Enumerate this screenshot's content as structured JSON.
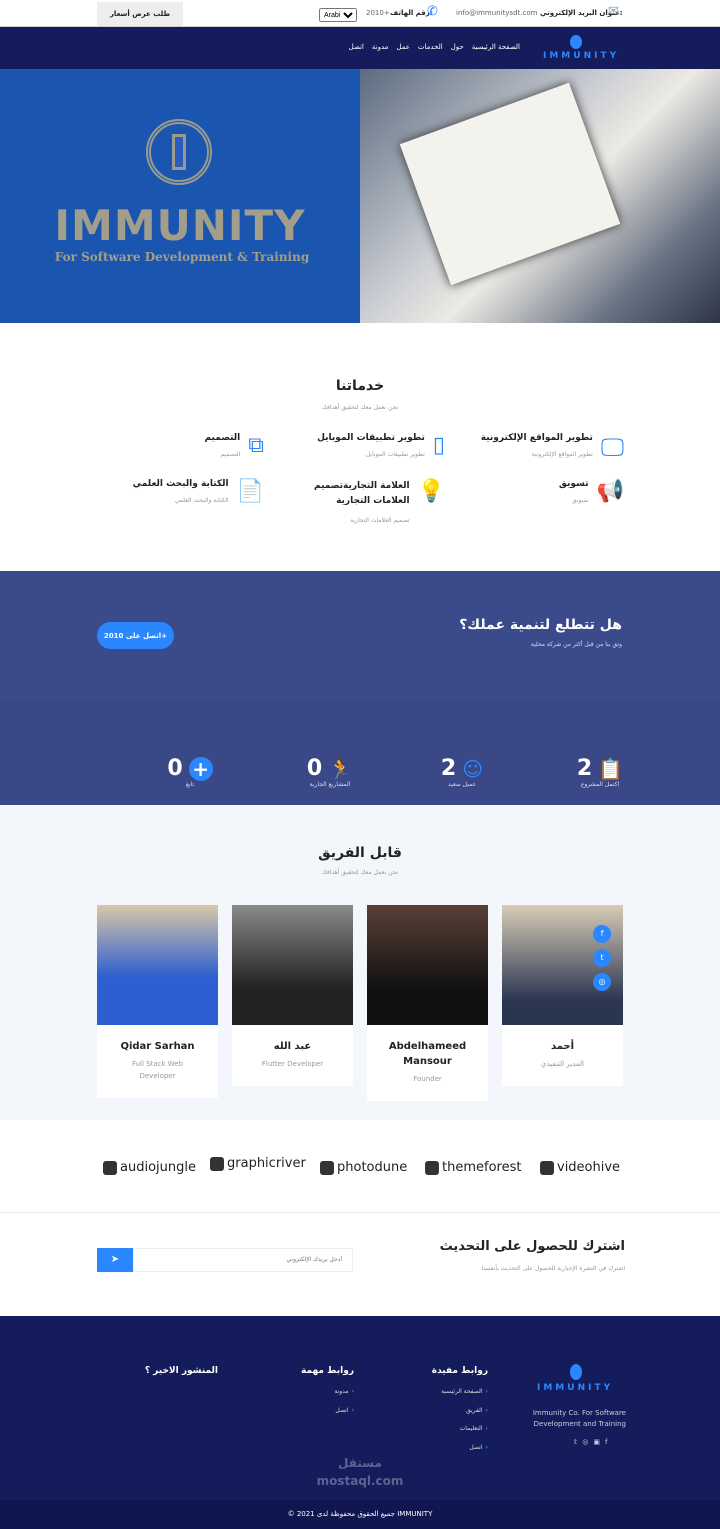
{
  "topbar": {
    "quote_button": "طلب عرض أسعار",
    "language": "Arabic",
    "phone_label": "رقم الهاتف:",
    "phone": "2010+",
    "email_label": "عنوان البريد الإلكتروني:",
    "email": "info@immunitysdt.com"
  },
  "nav": {
    "logo": "IMMUNITY",
    "items": [
      "الصفحة الرئيسية",
      "حول",
      "الخدمات",
      "عمل",
      "مدونة",
      "اتصل"
    ]
  },
  "hero": {
    "brand": "IMMUNITY",
    "tagline": "For Software Development & Training"
  },
  "services": {
    "title": "خدماتنا",
    "subtitle": "نحن نعمل معك لتحقيق أهدافك",
    "items": [
      {
        "title": "تطوير المواقع الإلكترونية",
        "desc": "تطوير المواقع الإلكترونية",
        "icon": "monitor-icon"
      },
      {
        "title": "تطوير تطبيقات الموبايل",
        "desc": "تطوير تطبيقات الموبايل",
        "icon": "mobile-icon"
      },
      {
        "title": "التصميم",
        "desc": "التصميم",
        "icon": "design-icon"
      },
      {
        "title": "تسويق",
        "desc": "تسويق",
        "icon": "megaphone-icon"
      },
      {
        "title": "العلامة التجاريةتصميم العلامات التجارية",
        "desc": "تصميم العلامات التجارية",
        "icon": "lightbulb-icon"
      },
      {
        "title": "الكتابة والبحث العلمي",
        "desc": "الكتابة والبحث العلمي",
        "icon": "document-icon"
      }
    ]
  },
  "cta": {
    "title": "هل تتطلع لتنمية عملك؟",
    "subtitle": "وثق بنا من قبل أكثر من شركة محلية",
    "button": "اتصل على 2010+"
  },
  "stats": [
    {
      "value": "2",
      "label": "اكتمل المشروع",
      "icon": "clipboard-icon"
    },
    {
      "value": "2",
      "label": "عميل سعيد",
      "icon": "smile-icon"
    },
    {
      "value": "0",
      "label": "المشاريع الجارية",
      "icon": "running-icon"
    },
    {
      "value": "0",
      "label": "تابع",
      "icon": "plus-circle-icon"
    }
  ],
  "team": {
    "title": "قابل الفريق",
    "subtitle": "نحن نعمل معك لتحقيق أهدافك",
    "members": [
      {
        "name": "Qidar Sarhan",
        "role": "Full Stack Web Developer"
      },
      {
        "name": "عبد الله",
        "role": "Flutter Developer"
      },
      {
        "name": "Abdelhameed Mansour",
        "role": "Founder"
      },
      {
        "name": "أحمد",
        "role": "المدير التنفيذي"
      }
    ]
  },
  "brands": [
    "audiojungle",
    "graphicriver",
    "photodune",
    "themeforest",
    "videohive"
  ],
  "subscribe": {
    "title": "اشترك للحصول على التحديث",
    "subtitle": "اشترك في النشرة الإخبارية للحصول على التحديث بأنفسنا",
    "placeholder": "أدخل بريدك الإلكتروني"
  },
  "footer": {
    "logo": "IMMUNITY",
    "about": "Immunity Co. For Software Development and Training",
    "col1_title": "روابط مفيدة",
    "col1": [
      "الصفحة الرئيسية",
      "الفريق",
      "التعليمات",
      "اتصل"
    ],
    "col2_title": "روابط مهمة",
    "col2": [
      "مدونة",
      "اتصل"
    ],
    "col3_title": "المنشور الاخير ؟",
    "watermark": "مستقل mostaql.com",
    "copyright": "© 2021 جميع الحقوق محفوظة لدى IMMUNITY"
  },
  "colors": {
    "accent": "#2a87ff",
    "navy": "#141c5c",
    "hero_blue": "#1a56b0"
  }
}
